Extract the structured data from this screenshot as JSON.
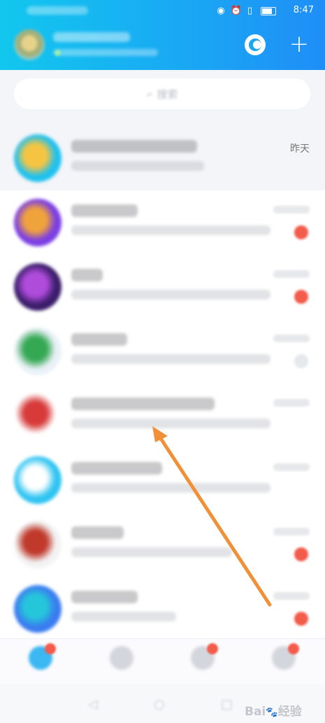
{
  "status_bar": {
    "carrier": "",
    "icons": [
      "eye-icon",
      "alarm-icon",
      "vibrate-icon",
      "battery-icon"
    ],
    "time": "8:47"
  },
  "header": {
    "profile_name": "",
    "profile_status": "",
    "accent_color": "#1aa6f4"
  },
  "search": {
    "placeholder": "搜索"
  },
  "conversations": [
    {
      "title": "",
      "preview": "",
      "time": "昨天",
      "badge": "",
      "pinned": true,
      "avatar_colors": [
        "#20c1ef",
        "#f5c542"
      ]
    },
    {
      "title": "",
      "preview": "",
      "time": "",
      "badge": "",
      "pinned": false,
      "avatar_colors": [
        "#7b3fe4",
        "#f1a33b"
      ]
    },
    {
      "title": "",
      "preview": "",
      "time": "",
      "badge": "",
      "pinned": false,
      "avatar_colors": [
        "#3b1e6b",
        "#b04cdc"
      ]
    },
    {
      "title": "",
      "preview": "",
      "time": "",
      "badge": "",
      "pinned": false,
      "avatar_colors": [
        "#eaf1f7",
        "#35a853"
      ]
    },
    {
      "title": "",
      "preview": "",
      "time": "",
      "badge": "",
      "pinned": false,
      "avatar_colors": [
        "#ffffff",
        "#d83a3a"
      ]
    },
    {
      "title": "",
      "preview": "",
      "time": "",
      "badge": "",
      "pinned": false,
      "avatar_colors": [
        "#2fc4f2",
        "#ffffff"
      ]
    },
    {
      "title": "",
      "preview": "",
      "time": "",
      "badge": "",
      "pinned": false,
      "avatar_colors": [
        "#f3f3f3",
        "#c0392b"
      ]
    },
    {
      "title": "",
      "preview": "",
      "time": "",
      "badge": "",
      "pinned": false,
      "avatar_colors": [
        "#3a7cf0",
        "#26c6da"
      ]
    }
  ],
  "tabbar": {
    "tabs": [
      {
        "label": "",
        "icon": "message-icon",
        "active": true
      },
      {
        "label": "",
        "icon": "contacts-icon",
        "active": false
      },
      {
        "label": "",
        "icon": "watch-icon",
        "active": false
      },
      {
        "label": "",
        "icon": "explore-icon",
        "active": false
      }
    ]
  },
  "navbar": {
    "buttons": [
      "back-icon",
      "home-icon",
      "recents-icon"
    ]
  },
  "watermark": {
    "brand": "Bai",
    "suffix": "经验"
  },
  "annotation": {
    "arrow_color": "#f0913a"
  }
}
